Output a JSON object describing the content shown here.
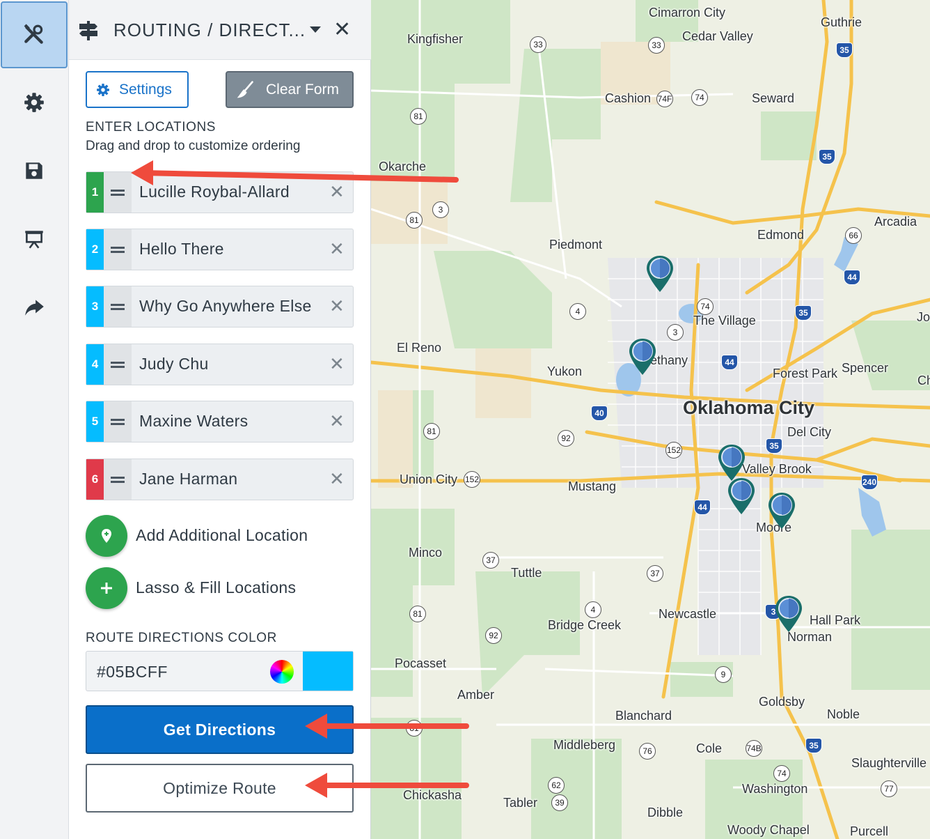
{
  "rail": {
    "items": [
      {
        "name": "tools-icon",
        "active": true
      },
      {
        "name": "gear-icon",
        "active": false
      },
      {
        "name": "save-icon",
        "active": false
      },
      {
        "name": "presentation-icon",
        "active": false
      },
      {
        "name": "share-icon",
        "active": false
      }
    ]
  },
  "panel": {
    "title": "ROUTING / DIRECT...",
    "close": "✕",
    "settings_label": "Settings",
    "clear_label": "Clear Form",
    "enter_locations": "ENTER LOCATIONS",
    "hint": "Drag and drop to customize ordering",
    "locations": [
      {
        "num": "1",
        "name": "Lucille Roybal-Allard",
        "color": "#2da44e"
      },
      {
        "num": "2",
        "name": "Hello There",
        "color": "#05bcff"
      },
      {
        "num": "3",
        "name": "Why Go Anywhere Else",
        "color": "#05bcff"
      },
      {
        "num": "4",
        "name": "Judy Chu",
        "color": "#05bcff"
      },
      {
        "num": "5",
        "name": "Maxine Waters",
        "color": "#05bcff"
      },
      {
        "num": "6",
        "name": "Jane Harman",
        "color": "#e03a4a"
      }
    ],
    "remove_glyph": "✕",
    "add_location_label": "Add Additional Location",
    "lasso_label": "Lasso & Fill Locations",
    "route_color_heading": "ROUTE DIRECTIONS COLOR",
    "route_color_value": "#05BCFF",
    "get_directions_label": "Get Directions",
    "optimize_label": "Optimize Route"
  },
  "map": {
    "places": [
      {
        "name": "Cimarron City"
      },
      {
        "name": "Guthrie"
      },
      {
        "name": "Kingfisher"
      },
      {
        "name": "Cedar Valley"
      },
      {
        "name": "Cashion"
      },
      {
        "name": "Seward"
      },
      {
        "name": "Okarche"
      },
      {
        "name": "Arcadia"
      },
      {
        "name": "Edmond"
      },
      {
        "name": "Piedmont"
      },
      {
        "name": "The Village"
      },
      {
        "name": "Jon"
      },
      {
        "name": "El Reno"
      },
      {
        "name": "ethany"
      },
      {
        "name": "Yukon"
      },
      {
        "name": "Forest Park"
      },
      {
        "name": "Spencer"
      },
      {
        "name": "Ch"
      },
      {
        "name": "Oklahoma City"
      },
      {
        "name": "Del City"
      },
      {
        "name": "Valley Brook"
      },
      {
        "name": "Union City"
      },
      {
        "name": "Mustang"
      },
      {
        "name": "Moore"
      },
      {
        "name": "Minco"
      },
      {
        "name": "Tuttle"
      },
      {
        "name": "Newcastle"
      },
      {
        "name": "Bridge Creek"
      },
      {
        "name": "Hall Park"
      },
      {
        "name": "Norman"
      },
      {
        "name": "Pocasset"
      },
      {
        "name": "Amber"
      },
      {
        "name": "Goldsby"
      },
      {
        "name": "Blanchard"
      },
      {
        "name": "Noble"
      },
      {
        "name": "Middleberg"
      },
      {
        "name": "Cole"
      },
      {
        "name": "Slaughterville"
      },
      {
        "name": "Washington"
      },
      {
        "name": "Chickasha"
      },
      {
        "name": "Tabler"
      },
      {
        "name": "Dibble"
      },
      {
        "name": "Woody Chapel"
      },
      {
        "name": "Purcell"
      }
    ],
    "shields": [
      "33",
      "33",
      "35",
      "74F",
      "74",
      "81",
      "35",
      "3",
      "81",
      "66",
      "44",
      "74",
      "4",
      "3",
      "35",
      "44",
      "40",
      "81",
      "92",
      "152",
      "35",
      "152",
      "44",
      "240",
      "37",
      "37",
      "4",
      "81",
      "92",
      "3",
      "9",
      "81",
      "76",
      "74B",
      "35",
      "74",
      "62",
      "39",
      "77"
    ],
    "pin_color": "#1a6e6a"
  }
}
